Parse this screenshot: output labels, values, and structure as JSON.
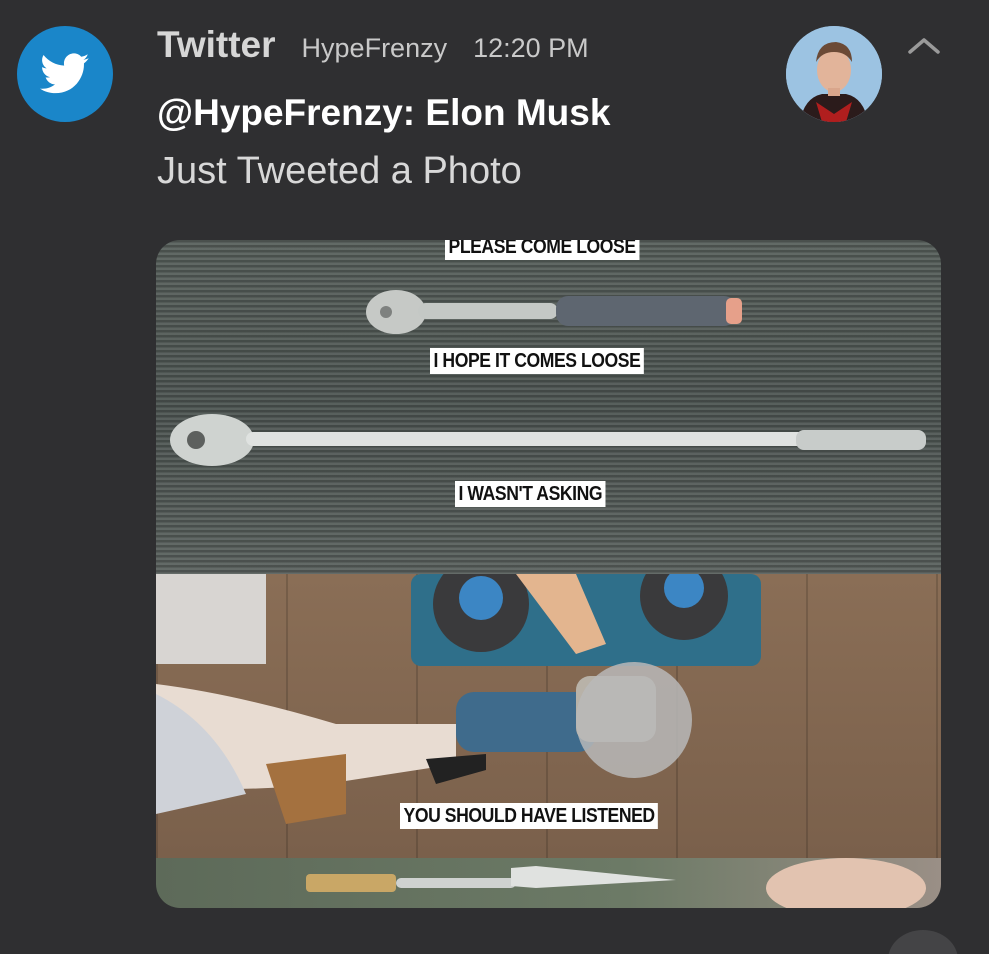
{
  "notification": {
    "app_name": "Twitter",
    "channel": "HypeFrenzy",
    "time": "12:20 PM",
    "title": "@HypeFrenzy: Elon Musk",
    "body": "Just Tweeted a Photo",
    "app_icon": "twitter-bird-icon",
    "avatar": "profile-photo",
    "collapse_icon": "chevron-up-icon",
    "accent_color": "#1a86c9"
  },
  "media": {
    "captions": [
      "PLEASE COME LOOSE",
      "I HOPE IT COMES LOOSE",
      "I WASN'T ASKING",
      "YOU SHOULD HAVE LISTENED"
    ]
  }
}
